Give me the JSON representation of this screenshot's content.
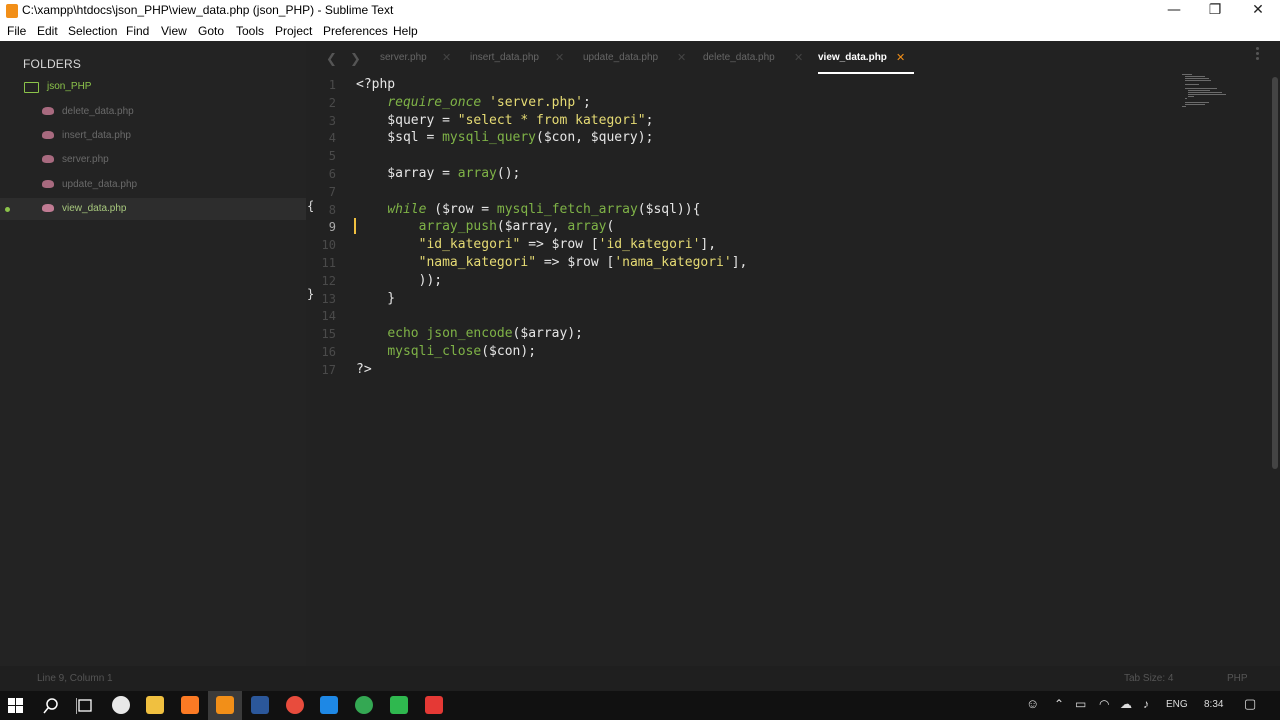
{
  "window": {
    "title": "C:\\xampp\\htdocs\\json_PHP\\view_data.php (json_PHP) - Sublime Text",
    "minimize_glyph": "—",
    "restore_glyph": "❐",
    "close_glyph": "✕"
  },
  "menu": {
    "items": [
      "File",
      "Edit",
      "Selection",
      "Find",
      "View",
      "Goto",
      "Tools",
      "Project",
      "Preferences",
      "Help"
    ]
  },
  "sidebar": {
    "header": "FOLDERS",
    "folder": "json_PHP",
    "files": [
      {
        "name": "delete_data.php",
        "active": false
      },
      {
        "name": "insert_data.php",
        "active": false
      },
      {
        "name": "server.php",
        "active": false
      },
      {
        "name": "update_data.php",
        "active": false
      },
      {
        "name": "view_data.php",
        "active": true
      }
    ]
  },
  "tabs": {
    "prev_glyph": "❮",
    "next_glyph": "❯",
    "close_glyph": "✕",
    "items": [
      {
        "label": "server.php",
        "active": false
      },
      {
        "label": "insert_data.php",
        "active": false
      },
      {
        "label": "update_data.php",
        "active": false
      },
      {
        "label": "delete_data.php",
        "active": false
      },
      {
        "label": "view_data.php",
        "active": true
      }
    ]
  },
  "editor": {
    "current_line": 9,
    "fold_open_glyph": "{",
    "fold_close_glyph": "}",
    "lines": [
      [
        [
          "t-plain",
          "<?php"
        ]
      ],
      [
        [
          "t-plain",
          "    "
        ],
        [
          "t-kw",
          "require_once"
        ],
        [
          "t-plain",
          " "
        ],
        [
          "t-str",
          "'server.php'"
        ],
        [
          "t-punct",
          ";"
        ]
      ],
      [
        [
          "t-plain",
          "    $query = "
        ],
        [
          "t-str",
          "\"select * from kategori\""
        ],
        [
          "t-punct",
          ";"
        ]
      ],
      [
        [
          "t-plain",
          "    $sql = "
        ],
        [
          "t-fn",
          "mysqli_query"
        ],
        [
          "t-plain",
          "($con, $query);"
        ]
      ],
      [],
      [
        [
          "t-plain",
          "    $array = "
        ],
        [
          "t-fn",
          "array"
        ],
        [
          "t-plain",
          "();"
        ]
      ],
      [],
      [
        [
          "t-plain",
          "    "
        ],
        [
          "t-kw",
          "while"
        ],
        [
          "t-plain",
          " ($row = "
        ],
        [
          "t-fn",
          "mysqli_fetch_array"
        ],
        [
          "t-plain",
          "($sql)){"
        ]
      ],
      [
        [
          "t-plain",
          "        "
        ],
        [
          "t-fn",
          "array_push"
        ],
        [
          "t-plain",
          "($array, "
        ],
        [
          "t-fn",
          "array"
        ],
        [
          "t-plain",
          "("
        ]
      ],
      [
        [
          "t-plain",
          "        "
        ],
        [
          "t-str",
          "\"id_kategori\""
        ],
        [
          "t-plain",
          " => $row ["
        ],
        [
          "t-str",
          "'id_kategori'"
        ],
        [
          "t-plain",
          "],"
        ]
      ],
      [
        [
          "t-plain",
          "        "
        ],
        [
          "t-str",
          "\"nama_kategori\""
        ],
        [
          "t-plain",
          " => $row ["
        ],
        [
          "t-str",
          "'nama_kategori'"
        ],
        [
          "t-plain",
          "],"
        ]
      ],
      [
        [
          "t-plain",
          "        ));"
        ]
      ],
      [
        [
          "t-plain",
          "    }"
        ]
      ],
      [],
      [
        [
          "t-plain",
          "    "
        ],
        [
          "t-fn",
          "echo"
        ],
        [
          "t-plain",
          " "
        ],
        [
          "t-fn",
          "json_encode"
        ],
        [
          "t-plain",
          "($array);"
        ]
      ],
      [
        [
          "t-plain",
          "    "
        ],
        [
          "t-fn",
          "mysqli_close"
        ],
        [
          "t-plain",
          "($con);"
        ]
      ],
      [
        [
          "t-plain",
          "?>"
        ]
      ]
    ]
  },
  "status": {
    "position": "Line 9, Column 1",
    "tab_size": "Tab Size: 4",
    "syntax": "PHP"
  },
  "taskbar": {
    "language": "ENG",
    "time": "8:34"
  },
  "colors": {
    "accent_orange": "#f28f18",
    "folder_green": "#8bc34a",
    "editor_bg": "#222222"
  }
}
